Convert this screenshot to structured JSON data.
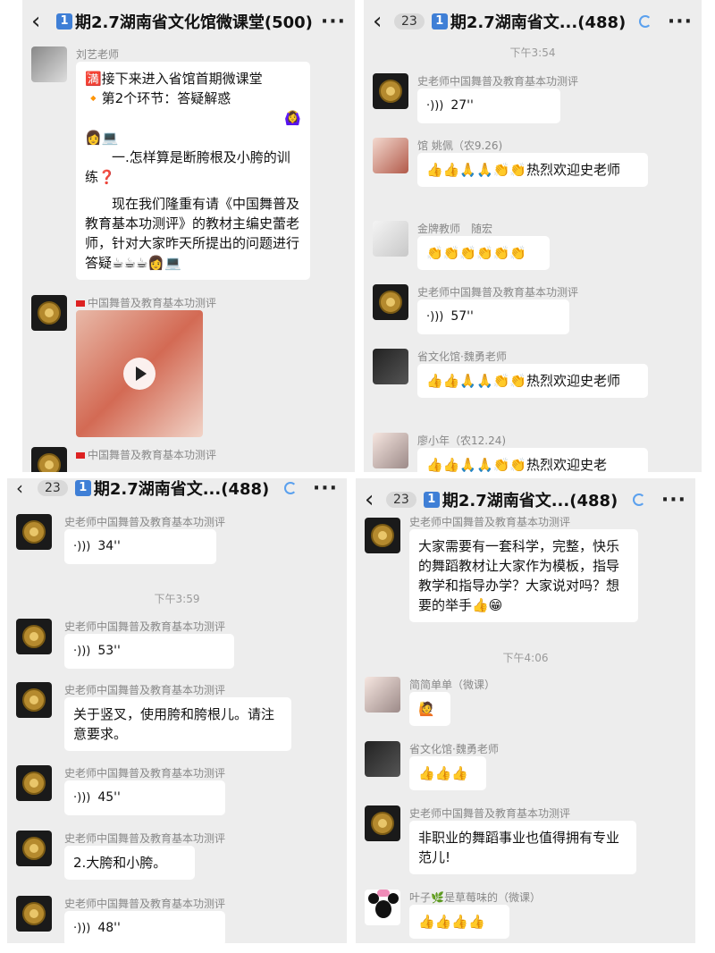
{
  "panel1": {
    "title": "期2.7湖南省文化馆微课堂(500)",
    "messages": {
      "liu_name": "刘艺老师",
      "liu_line1": "🈵接下来进入省馆首期微课堂",
      "liu_line2": "🔸第2个环节：答疑解惑",
      "liu_line3": "🙆‍♀️",
      "liu_line4": "👩💻",
      "liu_line5": "一.怎样算是断胯根及小胯的训练❓",
      "liu_line6": "现在我们隆重有请《中国舞普及教育基本功测评》的教材主编史蕾老师，针对大家昨天所提出的问题进行答疑☕☕☕👩💻",
      "video_name": "中国舞普及教育基本功测评",
      "next_name": "中国舞普及教育基本功测评"
    }
  },
  "panel2": {
    "unread": "23",
    "title": "期2.7湖南省文...(488)",
    "time": "下午3:54",
    "m1_name": "史老师中国舞普及教育基本功测评",
    "m1_voice": "27''",
    "m2_name": "馆 姚佩（农9.26)",
    "m2_text": "👍👍🙏🙏👏👏热烈欢迎史老师",
    "m3_name": "金牌教师　随宏",
    "m3_text": "👏👏👏👏👏👏",
    "m4_name": "史老师中国舞普及教育基本功测评",
    "m4_voice": "57''",
    "m5_name": "省文化馆·魏勇老师",
    "m5_text": "👍👍🙏🙏👏👏热烈欢迎史老师",
    "m6_name": "廖小年（农12.24)",
    "m6_text": "👍👍🙏🙏👏👏热烈欢迎史老"
  },
  "panel3": {
    "unread": "23",
    "title": "期2.7湖南省文...(488)",
    "time": "下午3:59",
    "m1_name": "史老师中国舞普及教育基本功测评",
    "m1_voice": "34''",
    "m2_name": "史老师中国舞普及教育基本功测评",
    "m2_voice": "53''",
    "m3_name": "史老师中国舞普及教育基本功测评",
    "m3_text": "关于竖叉，使用胯和胯根儿。请注意要求。",
    "m4_name": "史老师中国舞普及教育基本功测评",
    "m4_voice": "45''",
    "m5_name": "史老师中国舞普及教育基本功测评",
    "m5_text": "2.大胯和小胯。",
    "m6_name": "史老师中国舞普及教育基本功测评",
    "m6_voice": "48''"
  },
  "panel4": {
    "unread": "23",
    "title": "期2.7湖南省文...(488)",
    "top_name": "史老师中国舞普及教育基本功测评",
    "top_text": "大家需要有一套科学，完整，快乐的舞蹈教材让大家作为模板，指导教学和指导办学？大家说对吗？想要的举手👍😁",
    "time": "下午4:06",
    "m1_name": "简简单单（微课）",
    "m1_text": "🙋",
    "m2_name": "省文化馆·魏勇老师",
    "m2_text": "👍👍👍",
    "m3_name": "史老师中国舞普及教育基本功测评",
    "m3_text": "非职业的舞蹈事业也值得拥有专业范儿!",
    "m4_name": "叶子🌿是草莓味的（微课）",
    "m4_text": "👍👍👍👍"
  },
  "common": {
    "badge": "1",
    "back": "‹",
    "more": "···",
    "voice_icon": "⦾"
  }
}
